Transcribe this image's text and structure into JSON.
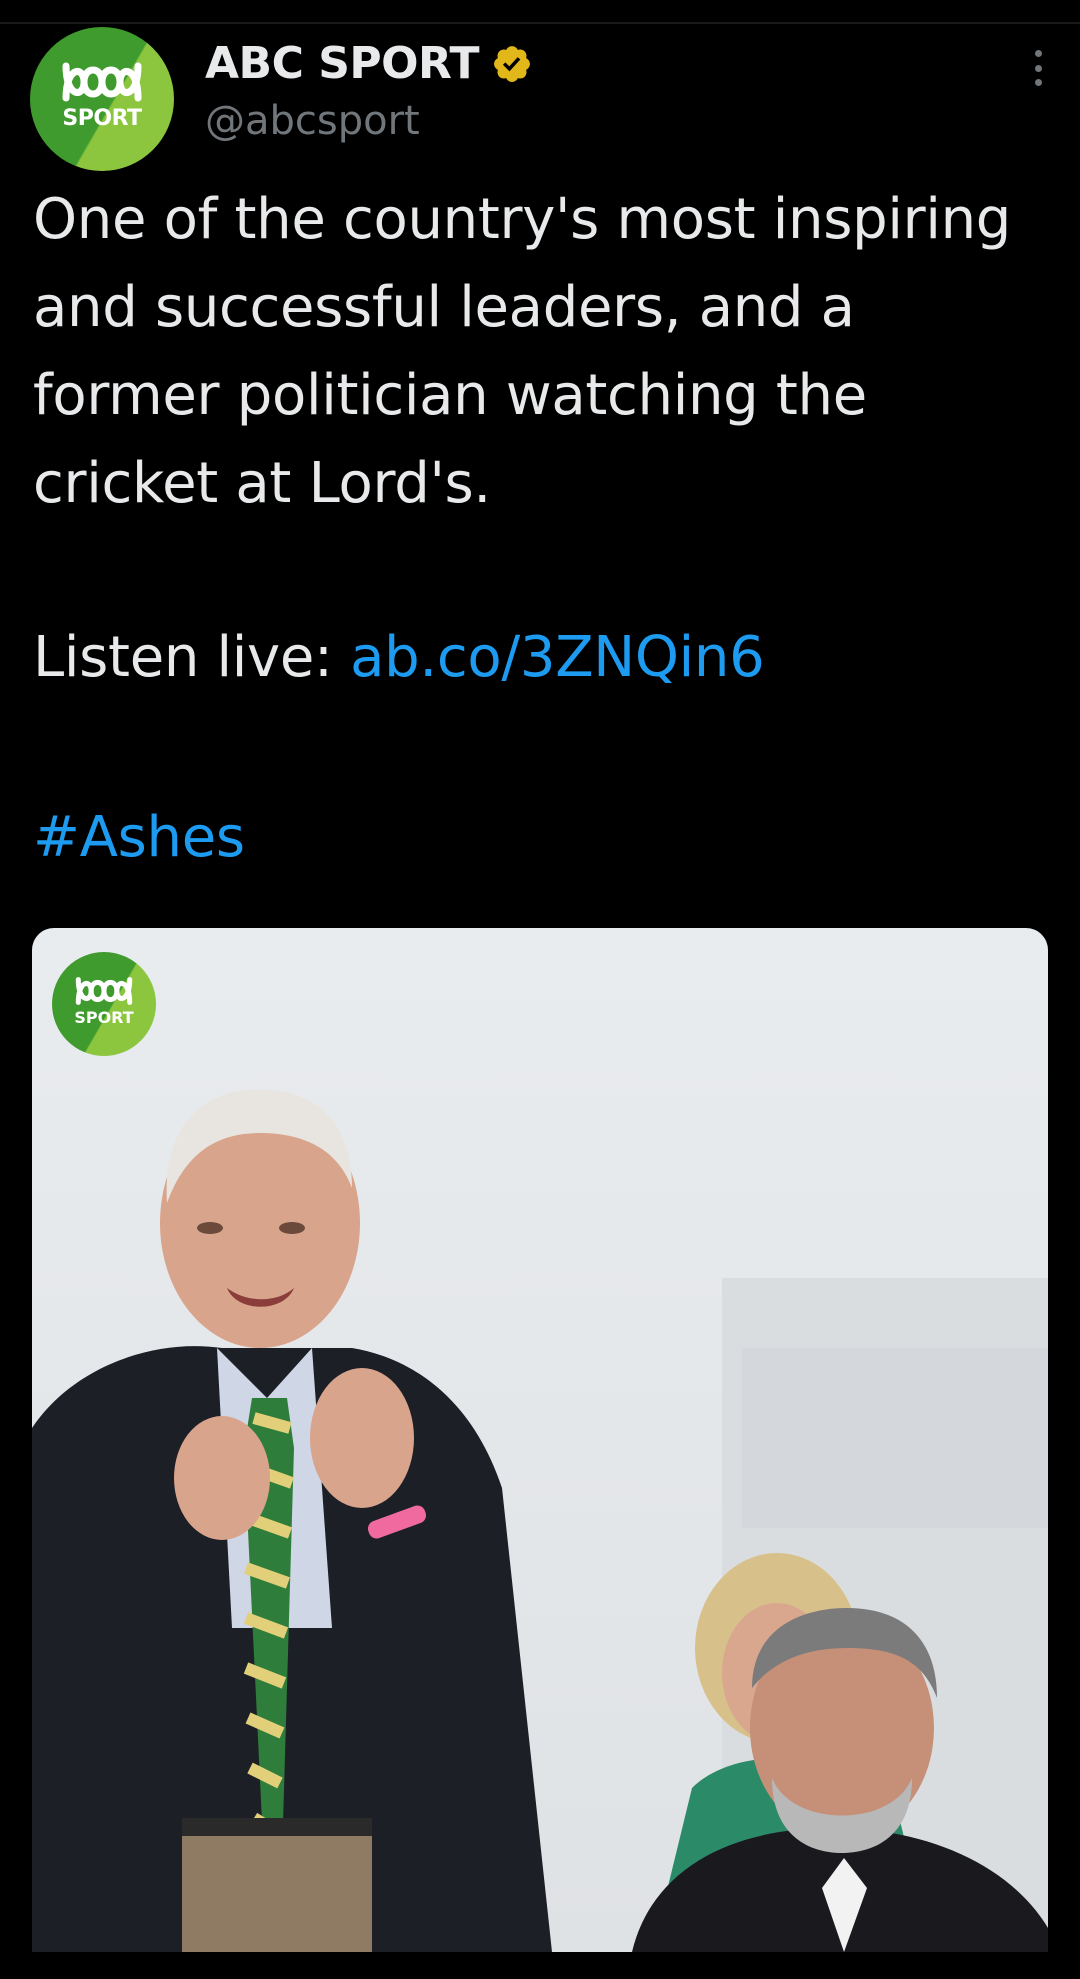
{
  "account": {
    "display_name": "ABC SPORT",
    "handle": "@abcsport",
    "avatar_text": "SPORT",
    "verified": true,
    "verified_color": "#e2b719"
  },
  "tweet": {
    "text": "One of the country's most inspiring and successful leaders, and a former politician watching the cricket at Lord's.",
    "listen_prefix": "Listen live: ",
    "link_text": "ab.co/3ZNQin6",
    "hashtag": "#Ashes"
  },
  "media": {
    "watermark_text": "SPORT"
  },
  "colors": {
    "background": "#000000",
    "text": "#e7e9ea",
    "secondary": "#71767b",
    "link": "#1d9bf0",
    "brand_green": "#3f9b2d",
    "brand_light_green": "#8cc63f"
  },
  "icons": {
    "more": "more-options-icon",
    "verified": "verified-badge-icon",
    "logo": "abc-logo-icon"
  }
}
